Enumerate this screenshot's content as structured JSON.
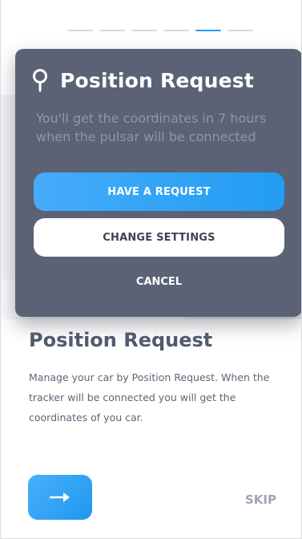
{
  "pager": {
    "count": 6,
    "active_index": 4
  },
  "colors": {
    "accent": "#2d9bf0",
    "card": "#5b6275",
    "title": "#525a6e"
  },
  "dialog": {
    "icon": "location-pin-icon",
    "title": "Position Request",
    "description": "You'll get the coordinates in 7 hours when the pulsar will be connected",
    "primary_label": "HAVE A REQUEST",
    "secondary_label": "CHANGE SETTINGS",
    "cancel_label": "CANCEL"
  },
  "main": {
    "title": "Position Request",
    "description": "Manage your car by Position Request. When the tracker will be connected you will get the coordinates of you car.",
    "next_icon": "arrow-right-icon",
    "skip_label": "SKIP"
  }
}
